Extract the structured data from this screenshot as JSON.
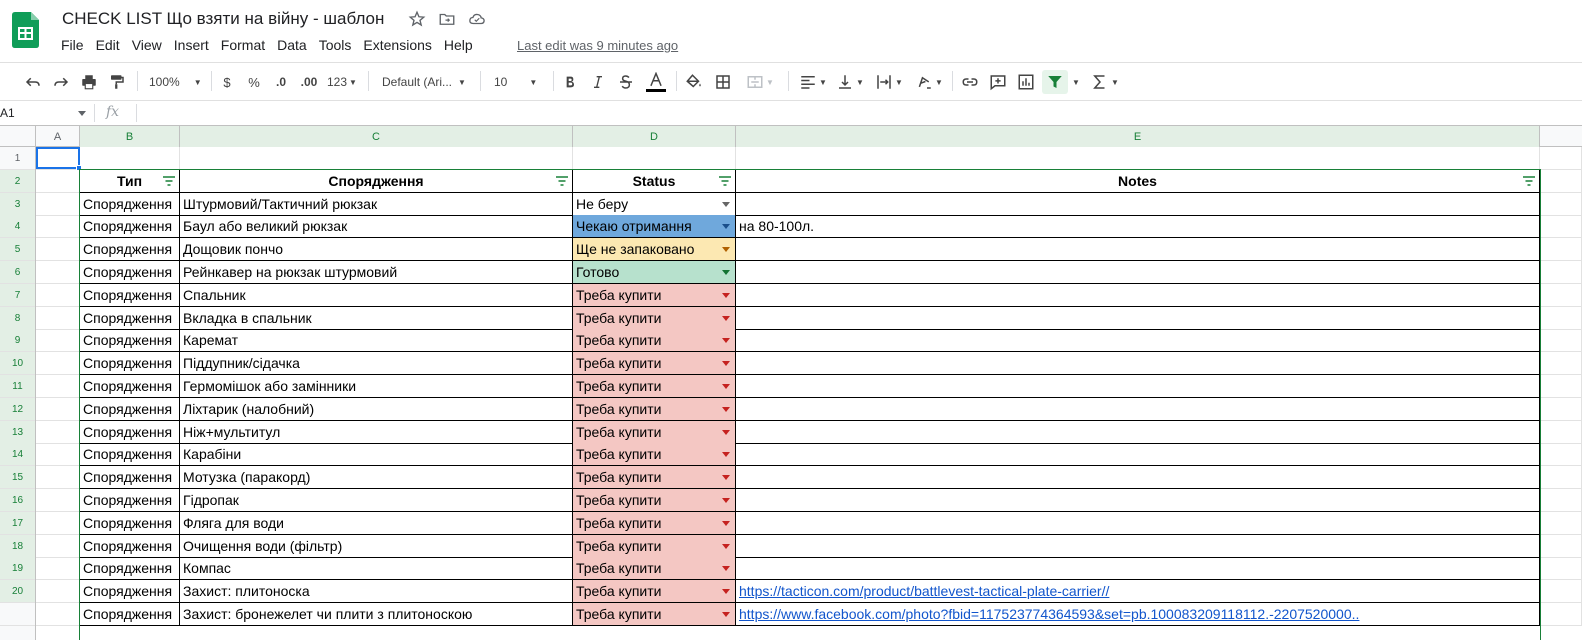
{
  "doc": {
    "title": "CHECK LIST Що взяти на війну - шаблон",
    "last_edit": "Last edit was 9 minutes ago"
  },
  "menu": [
    "File",
    "Edit",
    "View",
    "Insert",
    "Format",
    "Data",
    "Tools",
    "Extensions",
    "Help"
  ],
  "toolbar": {
    "zoom": "100%",
    "currency": "$",
    "percent": "%",
    "dec_less": ".0",
    "dec_more": ".00",
    "format_more": "123",
    "font": "Default (Ari...",
    "font_size": "10"
  },
  "formula_bar": {
    "cell_ref": "A1",
    "fx": "fx"
  },
  "columns": [
    "A",
    "B",
    "C",
    "D",
    "E"
  ],
  "rows": [
    "1",
    "2",
    "3",
    "4",
    "5",
    "6",
    "7",
    "8",
    "9",
    "10",
    "11",
    "12",
    "13",
    "14",
    "15",
    "16",
    "17",
    "18",
    "19",
    "20",
    ""
  ],
  "table": {
    "headers": [
      "Тип",
      "Спорядження",
      "Status",
      "Notes"
    ],
    "rows": [
      {
        "type": "Спорядження",
        "item": "Штурмовий/Тактичний рюкзак",
        "status": "Не беру",
        "status_color": "#ffffff",
        "notes": "",
        "link": false
      },
      {
        "type": "Спорядження",
        "item": "Баул або великий рюкзак",
        "status": "Чекаю отримання",
        "status_color": "#6fa8dc",
        "notes": "на 80-100л.",
        "link": false
      },
      {
        "type": "Спорядження",
        "item": "Дощовик пончо",
        "status": "Ще не запаковано",
        "status_color": "#fce8b2",
        "notes": "",
        "link": false
      },
      {
        "type": "Спорядження",
        "item": "Рейнкавер на рюкзак штурмовий",
        "status": "Готово",
        "status_color": "#b7e1cd",
        "notes": "",
        "link": false
      },
      {
        "type": "Спорядження",
        "item": "Спальник",
        "status": "Треба купити",
        "status_color": "#f4c7c3",
        "notes": "",
        "link": false
      },
      {
        "type": "Спорядження",
        "item": "Вкладка в спальник",
        "status": "Треба купити",
        "status_color": "#f4c7c3",
        "notes": "",
        "link": false
      },
      {
        "type": "Спорядження",
        "item": "Каремат",
        "status": "Треба купити",
        "status_color": "#f4c7c3",
        "notes": "",
        "link": false
      },
      {
        "type": "Спорядження",
        "item": "Піддупник/сідачка",
        "status": "Треба купити",
        "status_color": "#f4c7c3",
        "notes": "",
        "link": false
      },
      {
        "type": "Спорядження",
        "item": "Гермомішок або замінники",
        "status": "Треба купити",
        "status_color": "#f4c7c3",
        "notes": "",
        "link": false
      },
      {
        "type": "Спорядження",
        "item": "Ліхтарик (налобний)",
        "status": "Треба купити",
        "status_color": "#f4c7c3",
        "notes": "",
        "link": false
      },
      {
        "type": "Спорядження",
        "item": "Ніж+мультитул",
        "status": "Треба купити",
        "status_color": "#f4c7c3",
        "notes": "",
        "link": false
      },
      {
        "type": "Спорядження",
        "item": "Карабіни",
        "status": "Треба купити",
        "status_color": "#f4c7c3",
        "notes": "",
        "link": false
      },
      {
        "type": "Спорядження",
        "item": "Мотузка (паракорд)",
        "status": "Треба купити",
        "status_color": "#f4c7c3",
        "notes": "",
        "link": false
      },
      {
        "type": "Спорядження",
        "item": "Гідропак",
        "status": "Треба купити",
        "status_color": "#f4c7c3",
        "notes": "",
        "link": false
      },
      {
        "type": "Спорядження",
        "item": "Фляга для води",
        "status": "Треба купити",
        "status_color": "#f4c7c3",
        "notes": "",
        "link": false
      },
      {
        "type": "Спорядження",
        "item": "Очищення води (фільтр)",
        "status": "Треба купити",
        "status_color": "#f4c7c3",
        "notes": "",
        "link": false
      },
      {
        "type": "Спорядження",
        "item": "Компас",
        "status": "Треба купити",
        "status_color": "#f4c7c3",
        "notes": "",
        "link": false
      },
      {
        "type": "Спорядження",
        "item": "Захист: плитоноска",
        "status": "Треба купити",
        "status_color": "#f4c7c3",
        "notes": "https://tacticon.com/product/battlevest-tactical-plate-carrier//",
        "link": true
      },
      {
        "type": "Спорядження",
        "item": "Захист: бронежелет чи плити з плитоноскою",
        "status": "Треба купити",
        "status_color": "#f4c7c3",
        "notes": "https://www.facebook.com/photo?fbid=117523774364593&set=pb.100083209118112.-2207520000..",
        "link": true
      }
    ]
  },
  "colors": {
    "accent_green": "#188038",
    "selection_blue": "#1a73e8",
    "header_selected_bg": "#e3efe5"
  }
}
